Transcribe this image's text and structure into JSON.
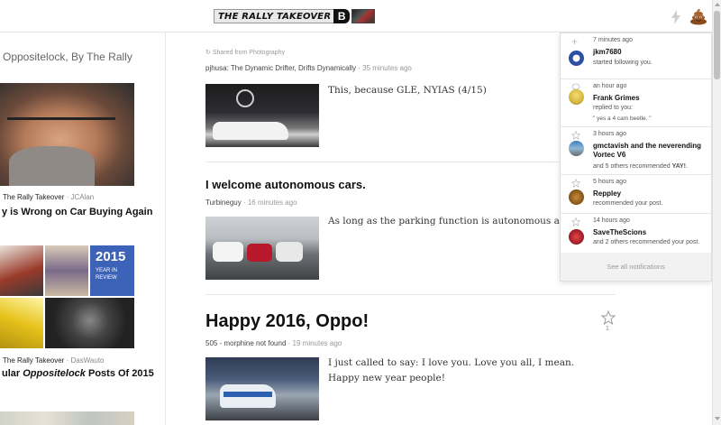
{
  "header": {
    "logo_text": "THE RALLY TAKEOVER",
    "logo_letter": "B",
    "bolt_icon": "lightning-bolt-icon",
    "avatar_icon": "poop-emoji-icon"
  },
  "left_column": {
    "title": "Oppositelock, By The Rally",
    "story1": {
      "blog": "The Rally Takeover",
      "author": "JCAlan",
      "headline": "y is Wrong on Car Buying Again"
    },
    "story2": {
      "blog": "The Rally Takeover",
      "author": "DasWauto",
      "headline_prefix": "ular ",
      "headline_italic": "Oppositelock",
      "headline_suffix": " Posts Of 2015",
      "tile_year": "2015",
      "tile_caption": "YEAR IN REVIEW"
    }
  },
  "main": {
    "post1": {
      "shared_from": "Shared from Photography",
      "byline": "pjhusa: The Dynamic Drifter, Drifts Dynamically",
      "time": "35 minutes ago",
      "excerpt": "This, because GLE, NYIAS (4/15)"
    },
    "post2": {
      "title": "I welcome autonomous cars.",
      "author": "Turbineguy",
      "time": "16 minutes ago",
      "excerpt": "As long as the parking function is autonomous also."
    },
    "post3": {
      "title": "Happy 2016, Oppo!",
      "author": "505 - morphine not found",
      "time": "19 minutes ago",
      "excerpt": "I just called to say: I love you. Love you all, I mean. Happy new year people!",
      "star_count": "1"
    }
  },
  "notifications": {
    "items": [
      {
        "time": "7 minutes ago",
        "user": "jkm7680",
        "action": "started following you.",
        "icon": "plus-icon"
      },
      {
        "time": "an hour ago",
        "user": "Frank Grimes",
        "action": "replied to you:",
        "quote": "\" yes a 4 cam beetle. \"",
        "icon": "speech-bubble-icon"
      },
      {
        "time": "3 hours ago",
        "user": "gmctavish and the neverending Vortec V6",
        "action_prefix": "and 5 others recommended ",
        "action_bold": "YAY!",
        "action_suffix": ".",
        "icon": "star-icon"
      },
      {
        "time": "5 hours ago",
        "user": "Reppley",
        "action": "recommended your post.",
        "icon": "star-icon"
      },
      {
        "time": "14 hours ago",
        "user": "SaveTheScions",
        "action": "and 2 others recommended your post.",
        "icon": "star-icon"
      }
    ],
    "footer": "See all notifications"
  },
  "colors": {
    "accent_red": "#b03030",
    "muted": "#999999"
  }
}
